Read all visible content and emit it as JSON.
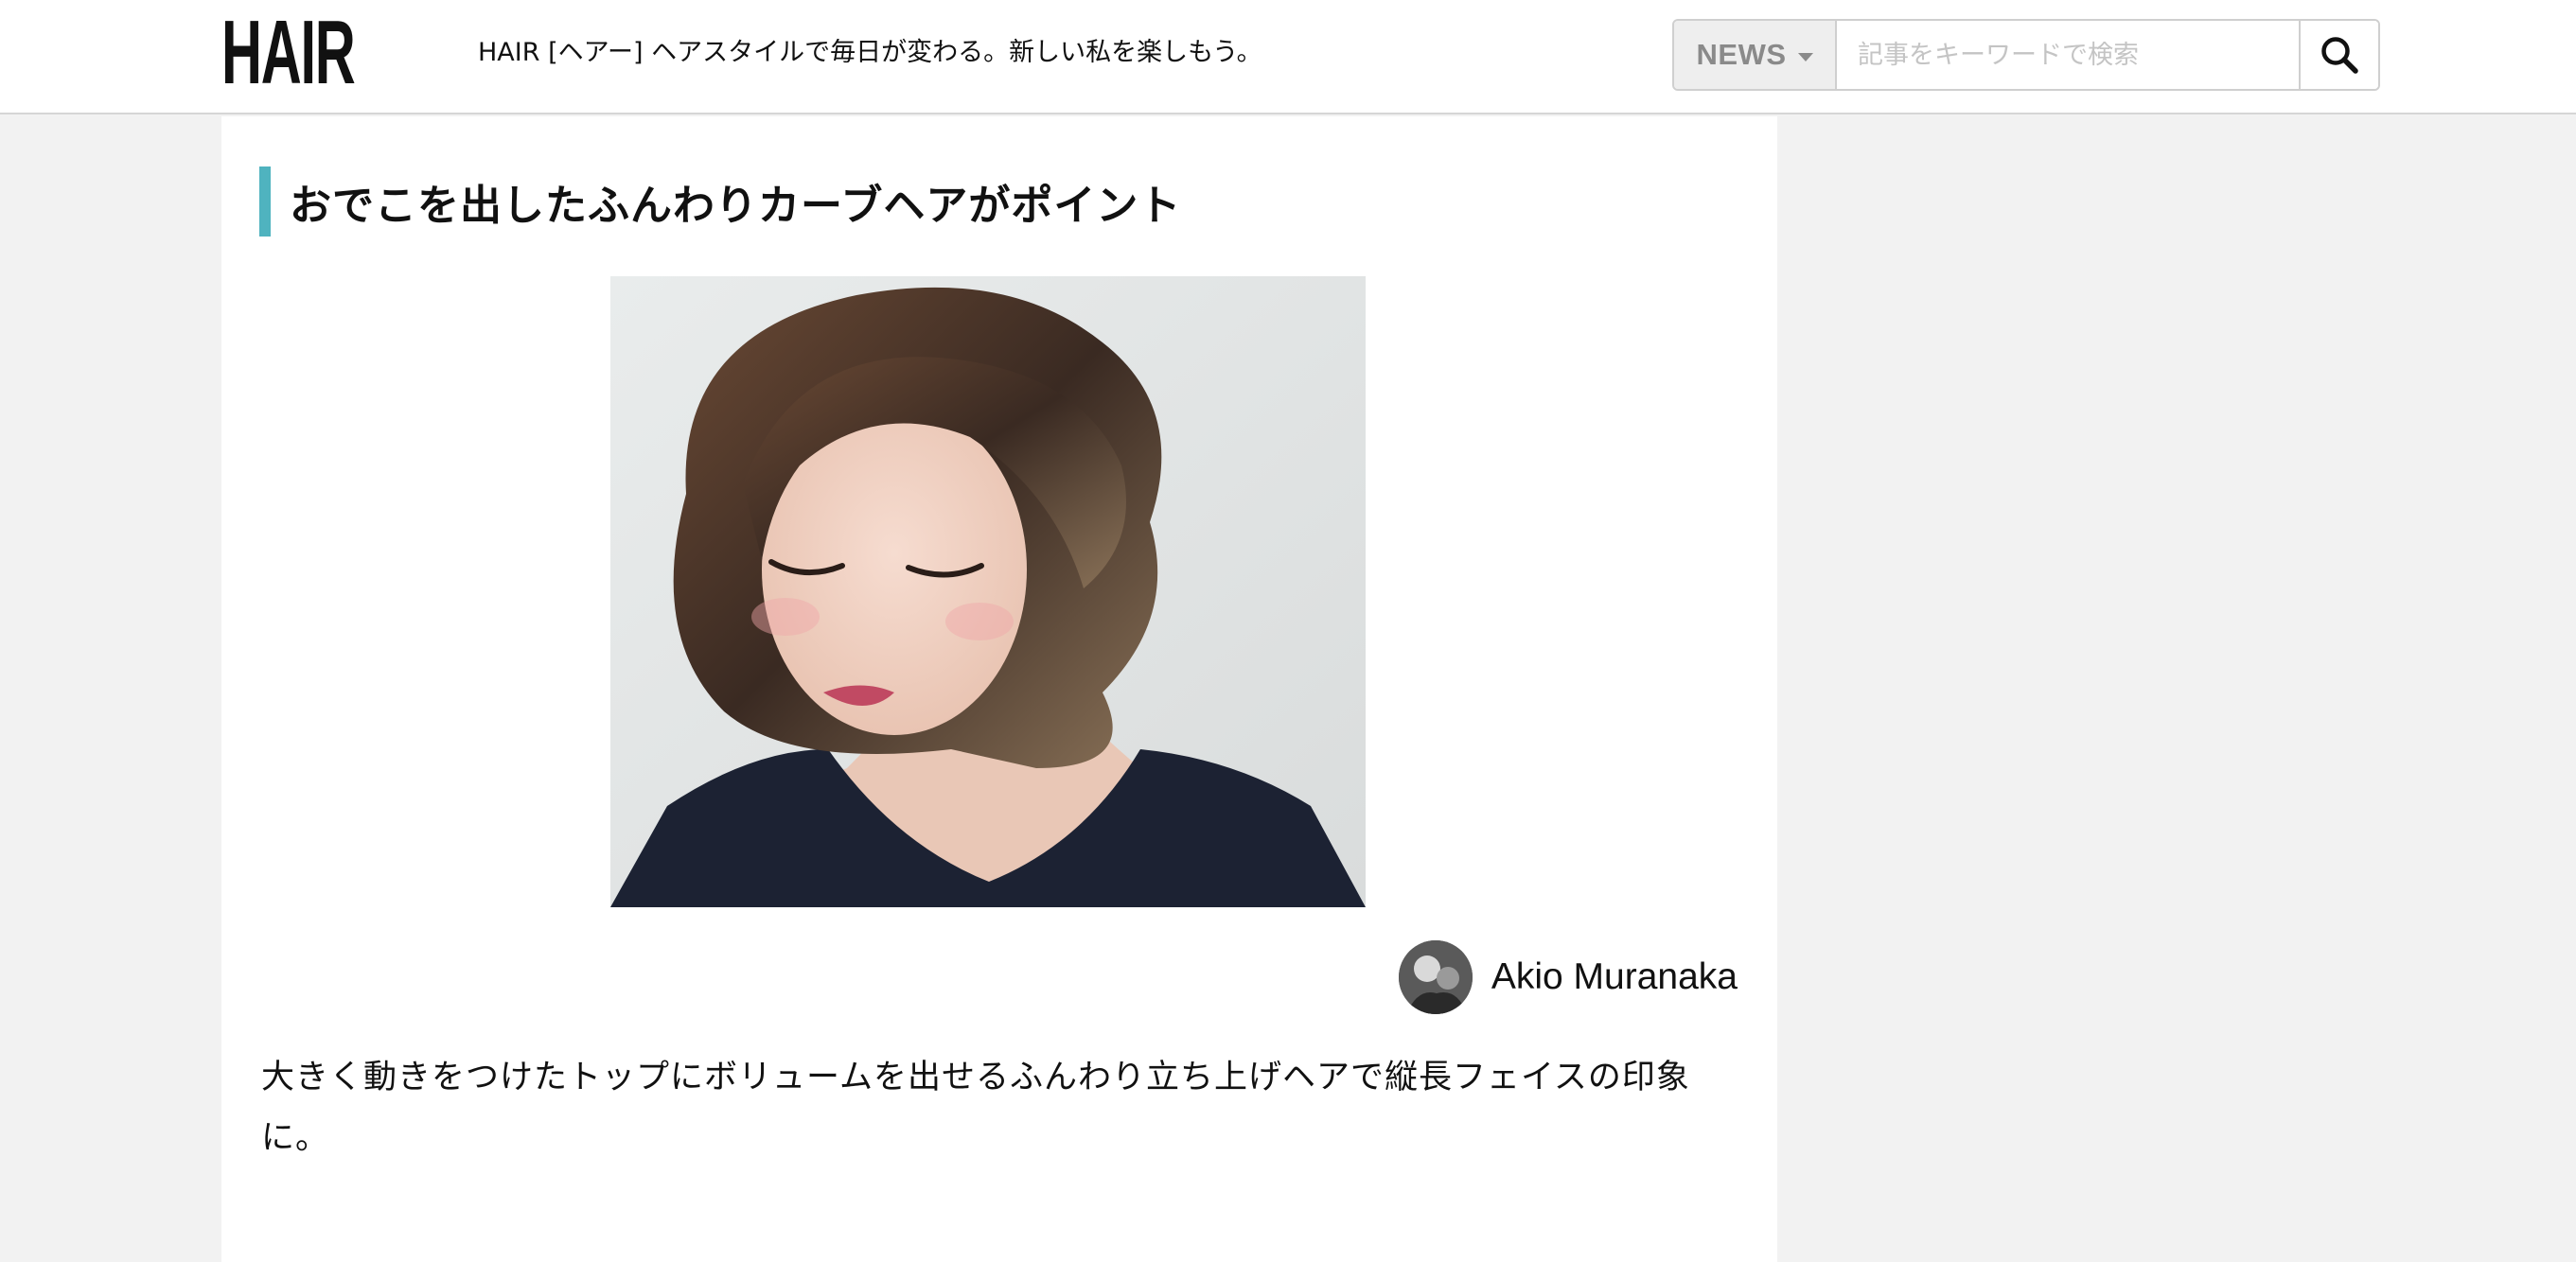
{
  "header": {
    "logo": "HAIR",
    "tagline": "HAIR [ヘアー] ヘアスタイルで毎日が変わる。新しい私を楽しもう。",
    "search": {
      "category": "NEWS",
      "placeholder": "記事をキーワードで検索",
      "icon": "search-icon"
    }
  },
  "article": {
    "heading": "おでこを出したふんわりカーブヘアがポイント",
    "accent_color": "#4fb3bf",
    "photo_alt": "hairstyle photo",
    "credit": {
      "name": "Akio Muranaka",
      "avatar_icon": "avatar"
    },
    "body": "大きく動きをつけたトップにボリュームを出せるふんわり立ち上げヘアで縦長フェイスの印象に。"
  }
}
